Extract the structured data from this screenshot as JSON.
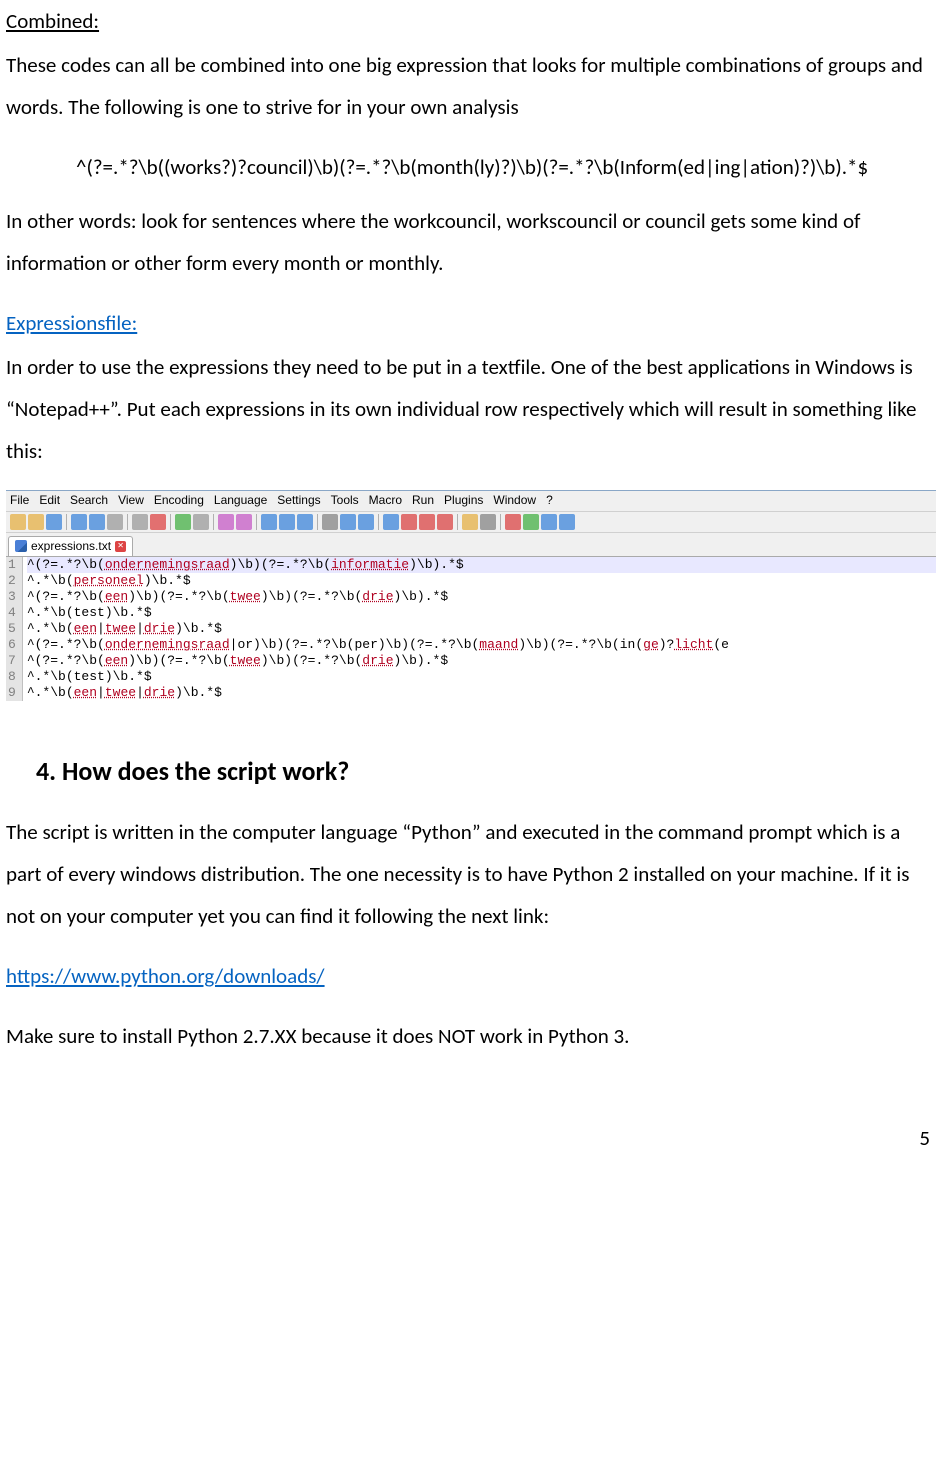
{
  "doc": {
    "combined_label": "Combined:",
    "combined_p": "These codes can all be combined into one big expression that looks for multiple combinations of groups and words. The following is one to strive for in your own analysis",
    "combined_regex": "^(?=.*?\\b((works?)?council)\\b)(?=.*?\\b(month(ly)?)\\b)(?=.*?\\b(Inform(ed|ing|ation)?)\\b).*$",
    "combined_p2": "In other words: look for sentences where the workcouncil, workscouncil or council gets some kind of information or other form every month or monthly.",
    "expr_label": "Expressionsfile:",
    "expr_p": "In order to use the expressions they need to be put in a textfile. One of the best applications in Windows is “Notepad++”. Put each expressions in its own individual row respectively which will result in something like this:",
    "heading4": "4. How does the script work?",
    "script_p1": "The script is written in the computer language “Python” and executed in the command prompt which is a part of every windows distribution. The one necessity is to have Python 2 installed on your machine. If it is not on your computer yet you can find it following the next link:",
    "python_url": "https://www.python.org/downloads/",
    "script_p2": "Make sure to install Python 2.7.XX because it does NOT work in Python 3.",
    "page_number": "5"
  },
  "npp": {
    "menus": [
      "File",
      "Edit",
      "Search",
      "View",
      "Encoding",
      "Language",
      "Settings",
      "Tools",
      "Macro",
      "Run",
      "Plugins",
      "Window",
      "?"
    ],
    "toolbar_colors": [
      "#e8c070",
      "#e8c070",
      "#6aa0e0",
      "#6aa0e0",
      "#6aa0e0",
      "#b0b0b0",
      "#b0b0b0",
      "#e27070",
      "#70c070",
      "#b0b0b0",
      "#d080d0",
      "#d080d0",
      "#6aa0e0",
      "#6aa0e0",
      "#6aa0e0",
      "#a0a0a0",
      "#6aa0e0",
      "#6aa0e0",
      "#6aa0e0",
      "#e07070",
      "#e07070",
      "#e07070",
      "#e8c070",
      "#a0a0a0",
      "#e07070",
      "#70c070",
      "#6aa0e0",
      "#6aa0e0"
    ],
    "tab_name": "expressions.txt",
    "tab_close": "✕",
    "lines": [
      {
        "n": "1",
        "raw": "^(?=.*?\\b(ondernemingsraad)\\b)(?=.*?\\b(informatie)\\b).*$",
        "words": [
          "ondernemingsraad",
          "informatie"
        ]
      },
      {
        "n": "2",
        "raw": "^.*\\b(personeel)\\b.*$",
        "words": [
          "personeel"
        ]
      },
      {
        "n": "3",
        "raw": "^(?=.*?\\b(een)\\b)(?=.*?\\b(twee)\\b)(?=.*?\\b(drie)\\b).*$",
        "words": [
          "een",
          "twee",
          "drie"
        ]
      },
      {
        "n": "4",
        "raw": "^.*\\b(test)\\b.*$",
        "words": []
      },
      {
        "n": "5",
        "raw": "^.*\\b(een|twee|drie)\\b.*$",
        "words": [
          "een",
          "twee",
          "drie"
        ]
      },
      {
        "n": "6",
        "raw": "^(?=.*?\\b(ondernemingsraad|or)\\b)(?=.*?\\b(per)\\b)(?=.*?\\b(maand)\\b)(?=.*?\\b(in(ge)?licht(e",
        "words": [
          "ondernemingsraad",
          "maand",
          "ge",
          "licht"
        ]
      },
      {
        "n": "7",
        "raw": "^(?=.*?\\b(een)\\b)(?=.*?\\b(twee)\\b)(?=.*?\\b(drie)\\b).*$",
        "words": [
          "een",
          "twee",
          "drie"
        ]
      },
      {
        "n": "8",
        "raw": "^.*\\b(test)\\b.*$",
        "words": []
      },
      {
        "n": "9",
        "raw": "^.*\\b(een|twee|drie)\\b.*$",
        "words": [
          "een",
          "twee",
          "drie"
        ]
      }
    ]
  }
}
